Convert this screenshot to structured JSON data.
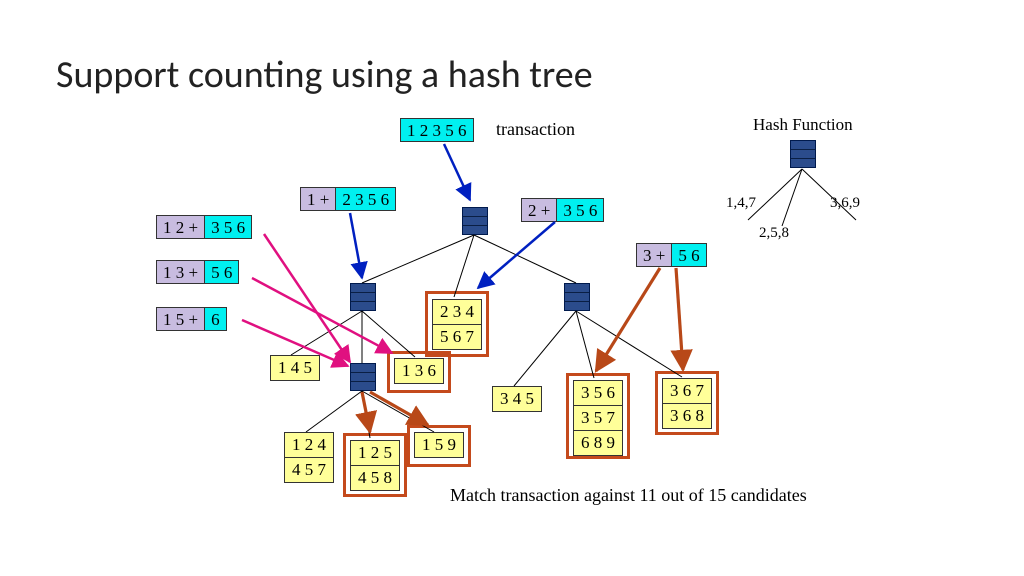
{
  "title": "Support counting using a hash tree",
  "transaction_items": "1 2 3 5 6",
  "transaction_label": "transaction",
  "hashfn_label": "Hash Function",
  "hashfn_branches": {
    "left": "1,4,7",
    "mid": "2,5,8",
    "right": "3,6,9"
  },
  "prefix_boxes": {
    "p1": {
      "a": "1 +",
      "b": "2 3 5 6"
    },
    "p2": {
      "a": "2 +",
      "b": "3 5 6"
    },
    "p12": {
      "a": "1 2 +",
      "b": "3 5 6"
    },
    "p13": {
      "a": "1 3 +",
      "b": "5 6"
    },
    "p3": {
      "a": "3 +",
      "b": "5 6"
    },
    "p15": {
      "a": "1 5 +",
      "b": "6"
    }
  },
  "leaves": {
    "l145": [
      "1 4 5"
    ],
    "l234": [
      "2 3 4",
      "5 6 7"
    ],
    "l136": [
      "1 3 6"
    ],
    "l345": [
      "3 4 5"
    ],
    "l356": [
      "3 5 6",
      "3 5 7",
      "6 8 9"
    ],
    "l367": [
      "3 6 7",
      "3 6 8"
    ],
    "l124": [
      "1 2 4",
      "4 5 7"
    ],
    "l125": [
      "1 2 5",
      "4 5 8"
    ],
    "l159": [
      "1 5 9"
    ]
  },
  "caption": "Match transaction against 11 out of 15 candidates"
}
